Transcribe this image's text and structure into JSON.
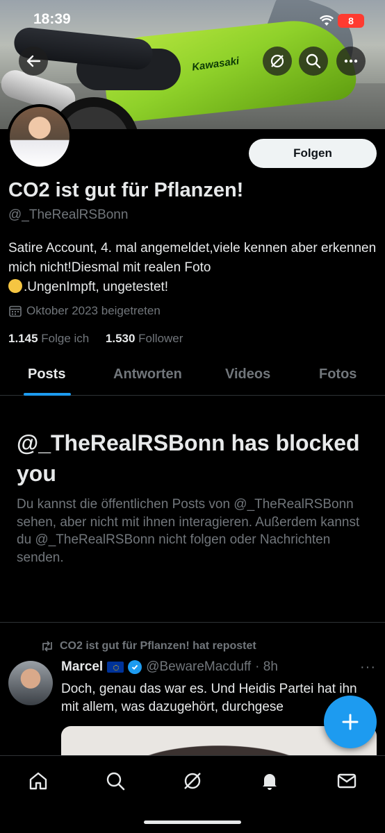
{
  "status_bar": {
    "time": "18:39",
    "battery": "8"
  },
  "banner": {
    "brand_text": "Kawasaki"
  },
  "profile": {
    "follow_label": "Folgen",
    "display_name": "CO2 ist gut für Pflanzen!",
    "handle": "@_TheRealRSBonn",
    "bio_line1": "Satire Account, 4. mal angemeldet,viele kennen aber erkennen mich nicht!Diesmal mit realen Foto",
    "bio_line2": ".UngenImpft, ungetestet!",
    "joined": "Oktober 2023 beigetreten",
    "following_count": "1.145",
    "following_label": "Folge ich",
    "followers_count": "1.530",
    "followers_label": "Follower"
  },
  "tabs": [
    {
      "label": "Posts",
      "active": true
    },
    {
      "label": "Antworten",
      "active": false
    },
    {
      "label": "Videos",
      "active": false
    },
    {
      "label": "Fotos",
      "active": false
    }
  ],
  "blocked": {
    "title": "@_TheRealRSBonn has blocked you",
    "text": "Du kannst die öffentlichen Posts von @_TheRealRSBonn sehen, aber nicht mit ihnen interagieren. Außerdem kannst du @_TheRealRSBonn nicht folgen oder Nachrichten senden."
  },
  "tweet": {
    "repost_label": "CO2 ist gut für Pflanzen! hat repostet",
    "author_name": "Marcel",
    "author_handle": "@BewareMacduff",
    "time": "· 8h",
    "more": "···",
    "text": "Doch, genau das war es. Und Heidis Partei hat ihn mit allem, was dazugehört, durchgese"
  },
  "colors": {
    "accent": "#1d9bf0",
    "background": "#000000",
    "muted": "#71767b",
    "text": "#e7e9ea"
  }
}
